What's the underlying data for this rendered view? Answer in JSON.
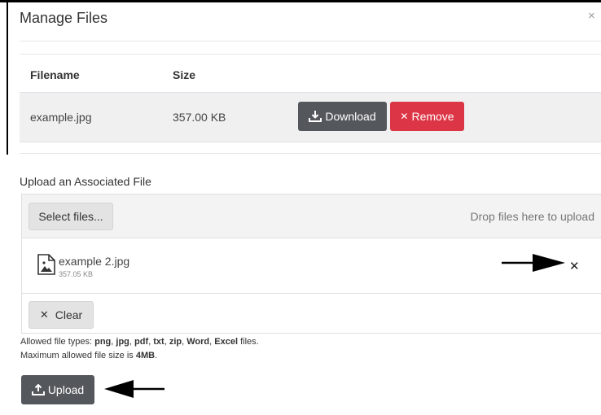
{
  "modal": {
    "title": "Manage Files",
    "close_glyph": "×"
  },
  "files_table": {
    "headers": [
      "Filename",
      "Size"
    ],
    "rows": [
      {
        "filename": "example.jpg",
        "size": "357.00 KB",
        "download_label": "Download",
        "remove_label": "Remove",
        "remove_glyph": "✕"
      }
    ]
  },
  "upload": {
    "heading": "Upload an Associated File",
    "select_label": "Select files...",
    "drop_hint": "Drop files here to upload",
    "queued_file": {
      "name": "example 2.jpg",
      "size": "357.05 KB",
      "remove_glyph": "✕"
    },
    "clear_label": "Clear",
    "clear_glyph": "✕",
    "allowed_prefix": "Allowed file types: ",
    "allowed_types": [
      "png",
      "jpg",
      "pdf",
      "txt",
      "zip",
      "Word",
      "Excel"
    ],
    "allowed_suffix": " files.",
    "max_prefix": "Maximum allowed file size is ",
    "max_size": "4MB",
    "max_suffix": ".",
    "upload_label": "Upload"
  },
  "icons": {
    "download": "download-icon",
    "upload": "upload-icon",
    "file": "image-file-icon",
    "arrow_to_remove": "arrow-right-icon",
    "arrow_to_upload": "arrow-left-icon"
  },
  "colors": {
    "dark_button": "#54585d",
    "danger_button": "#dc3545",
    "row_band": "#f0f0f0"
  }
}
